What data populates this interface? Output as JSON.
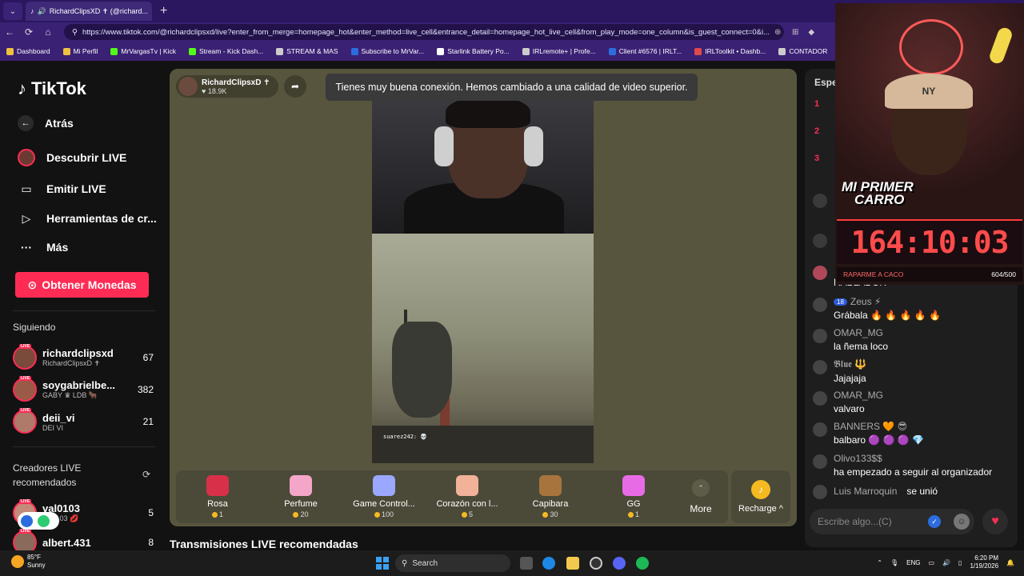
{
  "browser": {
    "tab_title": "RichardClipsXD ✝ (@richard...",
    "tab_close": "✕",
    "new_tab": "+",
    "url": "https://www.tiktok.com/@richardclipsxd/live?enter_from_merge=homepage_hot&enter_method=live_cell&entrance_detail=homepage_hot_live_cell&from_play_mode=one_column&is_guest_connect=0&i...",
    "bookmarks": [
      {
        "label": "Dashboard",
        "color": "#f0c040"
      },
      {
        "label": "Mi Perfil",
        "color": "#f0c040"
      },
      {
        "label": "MrVargasTv | Kick",
        "color": "#53fc18"
      },
      {
        "label": "Stream - Kick Dash...",
        "color": "#53fc18"
      },
      {
        "label": "STREAM & MAS",
        "color": "#cccccc"
      },
      {
        "label": "Subscribe to MrVar...",
        "color": "#2d6cdf"
      },
      {
        "label": "Starlink Battery Po...",
        "color": "#ffffff"
      },
      {
        "label": "IRLremote+ | Profe...",
        "color": "#cccccc"
      },
      {
        "label": "Client #6576 | IRLT...",
        "color": "#2d6cdf"
      },
      {
        "label": "IRLToolkit • Dashb...",
        "color": "#e04a4a"
      },
      {
        "label": "CONTADOR",
        "color": "#cccccc"
      }
    ]
  },
  "sidebar": {
    "logo": "TikTok",
    "back": "Atrás",
    "nav": [
      {
        "label": "Descubrir LIVE",
        "icon": "discover-live-icon"
      },
      {
        "label": "Emitir LIVE",
        "icon": "camera-icon"
      },
      {
        "label": "Herramientas de cr...",
        "icon": "creator-tools-icon"
      },
      {
        "label": "Más",
        "icon": "more-icon"
      }
    ],
    "coins_button": "Obtener Monedas",
    "following_title": "Siguiendo",
    "following": [
      {
        "name": "richardclipsxd",
        "sub": "RichardClipsxD ✝",
        "count": "67"
      },
      {
        "name": "soygabrielbe...",
        "sub": "GABY ♛ LDB 🐂",
        "count": "382"
      },
      {
        "name": "deii_vi",
        "sub": "DEI VI",
        "count": "21"
      }
    ],
    "recommended_title": "Creadores LIVE recomendados",
    "recommended": [
      {
        "name": "val0103",
        "sub": "val0103 💋",
        "count": "5"
      },
      {
        "name": "albert.431",
        "sub": "",
        "count": "8"
      }
    ],
    "live_tag": "LIVE"
  },
  "player": {
    "host_name": "RichardClipsxD ✝",
    "host_likes": "♥ 18.9K",
    "toast": "Tienes muy buena conexión. Hemos cambiado a una calidad de video superior.",
    "game_tag": "suarez242: 💀",
    "gifts": [
      {
        "name": "Rosa",
        "price": "1",
        "color": "#d9304a"
      },
      {
        "name": "Perfume",
        "price": "20",
        "color": "#f4a6c8"
      },
      {
        "name": "Game Control...",
        "price": "100",
        "color": "#9aa8ff"
      },
      {
        "name": "Corazón con l...",
        "price": "5",
        "color": "#f2b199"
      },
      {
        "name": "Capibara",
        "price": "30",
        "color": "#a8743e"
      },
      {
        "name": "GG",
        "price": "1",
        "color": "#e86be6"
      }
    ],
    "more_label": "More",
    "recharge_label": "Recharge ^"
  },
  "recommended_section_title": "Transmisiones LIVE recomendadas",
  "chat": {
    "header": "Espe",
    "ranks": [
      "1",
      "2",
      "3"
    ],
    "messages": [
      {
        "user": "Zeus ⚡",
        "level": "18",
        "text": "Grábala 🔥 🔥 🔥 🔥 🔥"
      },
      {
        "user": "OMAR_MG",
        "level": "",
        "text": "la ñema loco"
      },
      {
        "user": "𝕭𝖑𝖚𝖊 🔱",
        "level": "",
        "text": "Jajajaja"
      },
      {
        "user": "OMAR_MG",
        "level": "",
        "text": "valvaro"
      },
      {
        "user": "BANNERS 🧡 😎",
        "level": "",
        "text": "balbaro 🟣 🟣 🟣 💎"
      },
      {
        "user": "Olivo133$$",
        "level": "",
        "text": "ha empezado a seguir al organizador"
      },
      {
        "user": "Luis Marroquin",
        "level": "",
        "text": "se unió"
      }
    ],
    "partial_text": "HABLADOR",
    "input_placeholder": "Escribe algo...(C)"
  },
  "overlay": {
    "title_line1": "MI PRIMER",
    "title_line2": "CARRO",
    "cap_text": "NY",
    "timer": "164:10:03",
    "footer_left": "RAPARME A CACO",
    "footer_right": "604/500"
  },
  "taskbar": {
    "temp": "85°F",
    "condition": "Sunny",
    "search": "Search",
    "lang": "ENG",
    "time": "6:20 PM",
    "date": "1/19/2026"
  }
}
